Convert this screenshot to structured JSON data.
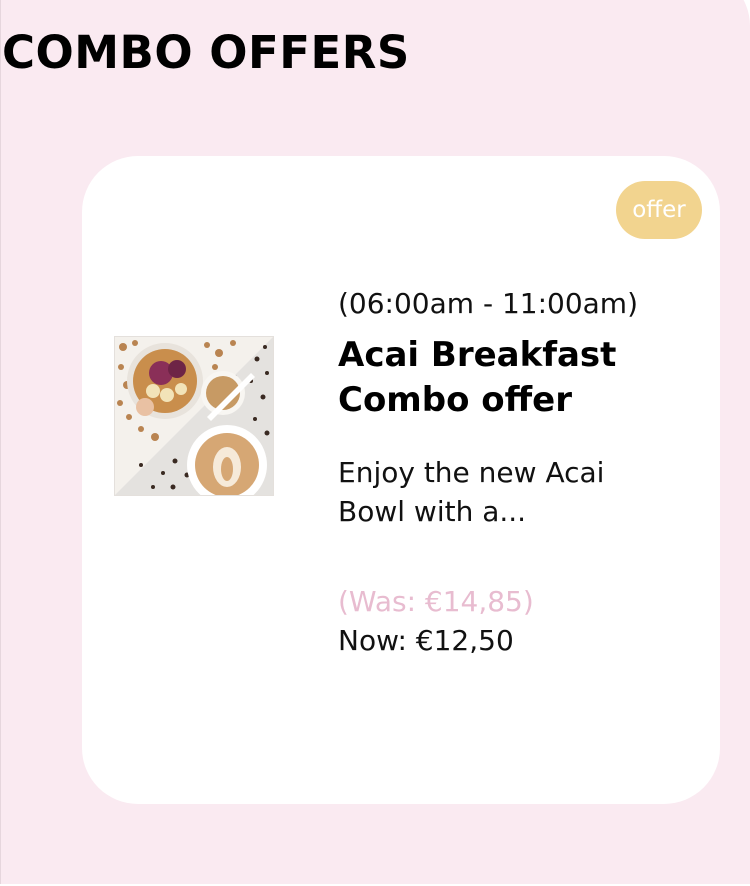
{
  "section": {
    "title": "COMBO OFFERS"
  },
  "offer": {
    "badge": "offer",
    "hours": "(06:00am - 11:00am)",
    "title": "Acai Breakfast Combo offer",
    "description": "Enjoy the new Acai Bowl with a...",
    "was_price": "(Was: €14,85)",
    "now_price": "Now: €12,50",
    "image_icon": "acai-bowl-and-latte-photo"
  },
  "colors": {
    "page_background": "#faeaf1",
    "card_background": "#ffffff",
    "badge_background": "#f2d48f",
    "badge_text": "#ffffff",
    "was_price_text": "#e8bcd0",
    "title_text": "#000000"
  }
}
